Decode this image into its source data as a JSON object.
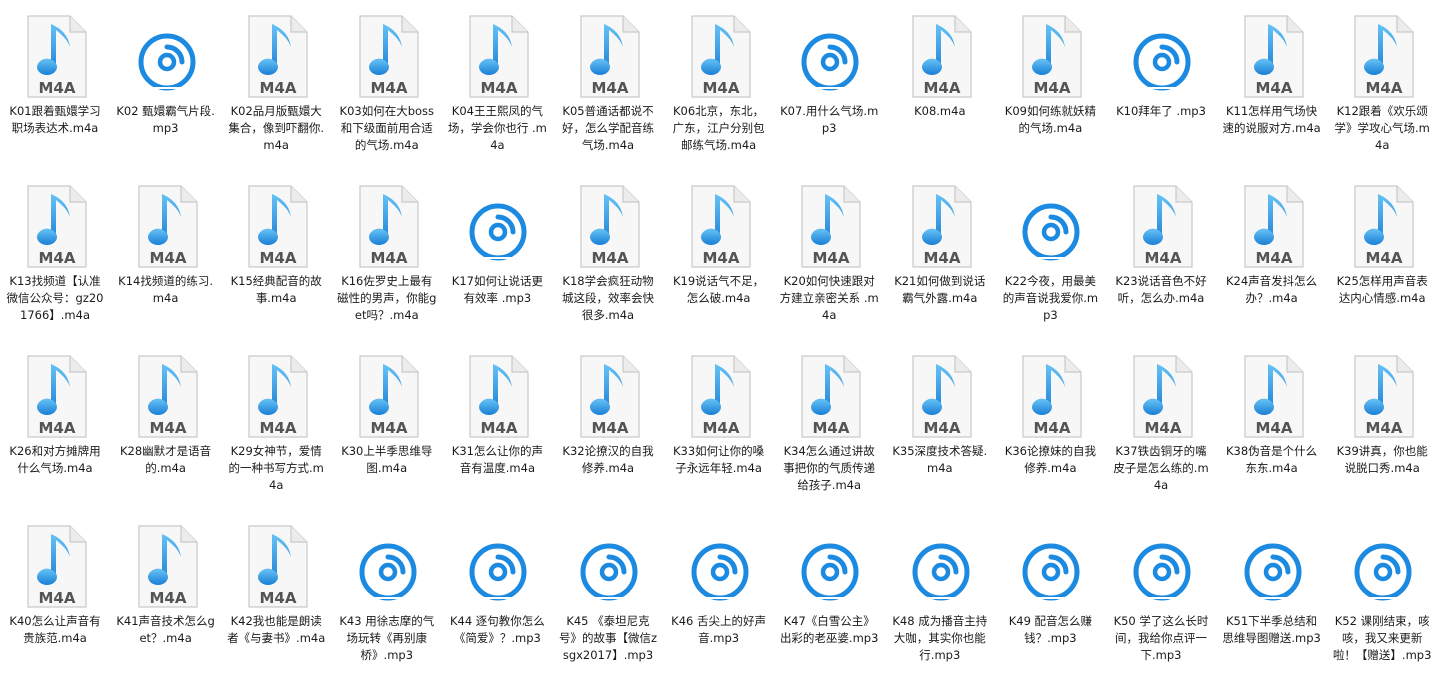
{
  "icon_colors": {
    "note_light": "#66c2f5",
    "note_dark": "#1a7fd6",
    "page_fill": "#f7f7f7",
    "page_border": "#c9c9c9",
    "badge_text": "#545454",
    "disc": "#1b8ae0"
  },
  "files": [
    {
      "name": "K01跟着甄嬛学习职场表达术.m4a",
      "icon": "m4a-file-icon",
      "badge": "M4A"
    },
    {
      "name": "K02 甄嬛霸气片段.mp3",
      "icon": "mp3-disc-icon"
    },
    {
      "name": "K02品月版甄嬛大集合，像到吓翻你.m4a",
      "icon": "m4a-file-icon",
      "badge": "M4A"
    },
    {
      "name": "K03如何在大boss和下级面前用合适的气场.m4a",
      "icon": "m4a-file-icon",
      "badge": "M4A"
    },
    {
      "name": "K04王王熙凤的气场，学会你也行 .m4a",
      "icon": "m4a-file-icon",
      "badge": "M4A"
    },
    {
      "name": "K05普通话都说不好，怎么学配音练气场.m4a",
      "icon": "m4a-file-icon",
      "badge": "M4A"
    },
    {
      "name": "K06北京，东北，广东，江户分别包邮练气场.m4a",
      "icon": "m4a-file-icon",
      "badge": "M4A"
    },
    {
      "name": "K07.用什么气场.mp3",
      "icon": "mp3-disc-icon"
    },
    {
      "name": "K08.m4a",
      "icon": "m4a-file-icon",
      "badge": "M4A"
    },
    {
      "name": "K09如何练就妖精的气场.m4a",
      "icon": "m4a-file-icon",
      "badge": "M4A"
    },
    {
      "name": "K10拜年了 .mp3",
      "icon": "mp3-disc-icon"
    },
    {
      "name": "K11怎样用气场快速的说服对方.m4a",
      "icon": "m4a-file-icon",
      "badge": "M4A"
    },
    {
      "name": "K12跟着《欢乐颂学》学攻心气场.m4a",
      "icon": "m4a-file-icon",
      "badge": "M4A"
    },
    {
      "name": "K13找频道【认准微信公众号：gz201766】.m4a",
      "icon": "m4a-file-icon",
      "badge": "M4A"
    },
    {
      "name": "K14找频道的练习.m4a",
      "icon": "m4a-file-icon",
      "badge": "M4A"
    },
    {
      "name": "K15经典配音的故事.m4a",
      "icon": "m4a-file-icon",
      "badge": "M4A"
    },
    {
      "name": "K16佐罗史上最有磁性的男声，你能get吗？.m4a",
      "icon": "m4a-file-icon",
      "badge": "M4A"
    },
    {
      "name": "K17如何让说话更有效率 .mp3",
      "icon": "mp3-disc-icon"
    },
    {
      "name": "K18学会疯狂动物城这段，效率会快很多.m4a",
      "icon": "m4a-file-icon",
      "badge": "M4A"
    },
    {
      "name": "K19说话气不足，怎么破.m4a",
      "icon": "m4a-file-icon",
      "badge": "M4A"
    },
    {
      "name": "K20如何快速跟对方建立亲密关系 .m4a",
      "icon": "m4a-file-icon",
      "badge": "M4A"
    },
    {
      "name": "K21如何做到说话霸气外露.m4a",
      "icon": "m4a-file-icon",
      "badge": "M4A"
    },
    {
      "name": "K22今夜，用最美的声音说我爱你.mp3",
      "icon": "mp3-disc-icon"
    },
    {
      "name": "K23说话音色不好听，怎么办.m4a",
      "icon": "m4a-file-icon",
      "badge": "M4A"
    },
    {
      "name": "K24声音发抖怎么办？.m4a",
      "icon": "m4a-file-icon",
      "badge": "M4A"
    },
    {
      "name": "K25怎样用声音表达内心情感.m4a",
      "icon": "m4a-file-icon",
      "badge": "M4A"
    },
    {
      "name": "K26和对方摊牌用什么气场.m4a",
      "icon": "m4a-file-icon",
      "badge": "M4A"
    },
    {
      "name": "K28幽默才是语音的.m4a",
      "icon": "m4a-file-icon",
      "badge": "M4A"
    },
    {
      "name": "K29女神节，爱情的一种书写方式.m4a",
      "icon": "m4a-file-icon",
      "badge": "M4A"
    },
    {
      "name": "K30上半季思维导图.m4a",
      "icon": "m4a-file-icon",
      "badge": "M4A"
    },
    {
      "name": "K31怎么让你的声音有温度.m4a",
      "icon": "m4a-file-icon",
      "badge": "M4A"
    },
    {
      "name": "K32论撩汉的自我修养.m4a",
      "icon": "m4a-file-icon",
      "badge": "M4A"
    },
    {
      "name": "K33如何让你的嗓子永远年轻.m4a",
      "icon": "m4a-file-icon",
      "badge": "M4A"
    },
    {
      "name": "K34怎么通过讲故事把你的气质传递给孩子.m4a",
      "icon": "m4a-file-icon",
      "badge": "M4A"
    },
    {
      "name": "K35深度技术答疑.m4a",
      "icon": "m4a-file-icon",
      "badge": "M4A"
    },
    {
      "name": "K36论撩妹的自我修养.m4a",
      "icon": "m4a-file-icon",
      "badge": "M4A"
    },
    {
      "name": "K37铁齿铜牙的嘴皮子是怎么练的.m4a",
      "icon": "m4a-file-icon",
      "badge": "M4A"
    },
    {
      "name": "K38伪音是个什么东东.m4a",
      "icon": "m4a-file-icon",
      "badge": "M4A"
    },
    {
      "name": "K39讲真，你也能说脱口秀.m4a",
      "icon": "m4a-file-icon",
      "badge": "M4A"
    },
    {
      "name": "K40怎么让声音有贵族范.m4a",
      "icon": "m4a-file-icon",
      "badge": "M4A"
    },
    {
      "name": "K41声音技术怎么get？.m4a",
      "icon": "m4a-file-icon",
      "badge": "M4A"
    },
    {
      "name": "K42我也能是朗读者《与妻书》.m4a",
      "icon": "m4a-file-icon",
      "badge": "M4A"
    },
    {
      "name": "K43 用徐志摩的气场玩转《再别康桥》.mp3",
      "icon": "mp3-disc-icon"
    },
    {
      "name": "K44 逐句教你怎么《简爱》？.mp3",
      "icon": "mp3-disc-icon"
    },
    {
      "name": "K45 《泰坦尼克号》的故事【微信zsgx2017】.mp3",
      "icon": "mp3-disc-icon"
    },
    {
      "name": "K46 舌尖上的好声音.mp3",
      "icon": "mp3-disc-icon"
    },
    {
      "name": "K47《白雪公主》出彩的老巫婆.mp3",
      "icon": "mp3-disc-icon"
    },
    {
      "name": "K48 成为播音主持大咖，其实你也能行.mp3",
      "icon": "mp3-disc-icon"
    },
    {
      "name": "K49 配音怎么赚钱？.mp3",
      "icon": "mp3-disc-icon"
    },
    {
      "name": "K50 学了这么长时间，我给你点评一下.mp3",
      "icon": "mp3-disc-icon"
    },
    {
      "name": "K51下半季总结和思维导图赠送.mp3",
      "icon": "mp3-disc-icon"
    },
    {
      "name": "K52 课刚结束，咳咳，我又来更新啦！【赠送】.mp3",
      "icon": "mp3-disc-icon"
    }
  ]
}
